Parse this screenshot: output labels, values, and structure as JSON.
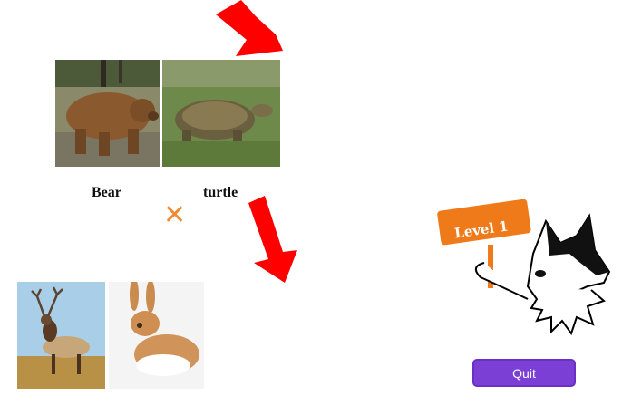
{
  "top_pair": {
    "left_name": "Bear",
    "right_name": "turtle",
    "left_image": "bear-photo",
    "right_image": "turtle-photo"
  },
  "operator": {
    "symbol": "✕",
    "color": "#f08a33"
  },
  "answer_options": [
    {
      "image": "elk-photo"
    },
    {
      "image": "rabbit-photo"
    }
  ],
  "arrows": {
    "color": "#ff0000"
  },
  "mascot": {
    "sign_text": "Level 1",
    "sign_color": "#ef7a1a",
    "image": "husky-dog-holding-sign"
  },
  "quit_button": {
    "label": "Quit",
    "color": "#7b3fd6"
  }
}
